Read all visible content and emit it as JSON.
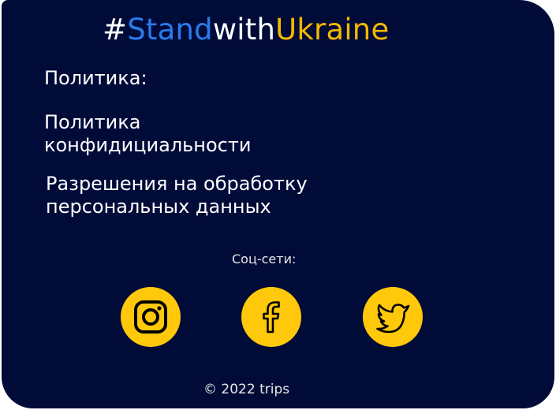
{
  "hashtag": {
    "prefix": "#",
    "part1": "Stand",
    "part2": "with",
    "part3": "Ukraine"
  },
  "policy": {
    "heading": "Политика:",
    "privacy_line1": "Политика",
    "privacy_line2": "конфидициальности",
    "consent_line1": "Разрешения на обработку",
    "consent_line2": "персональных данных"
  },
  "social": {
    "heading": "Соц-сети:",
    "links": [
      "instagram",
      "facebook",
      "twitter"
    ]
  },
  "copyright": "© 2022 trips",
  "colors": {
    "background": "#000b38",
    "accent_blue": "#2a7bec",
    "accent_yellow": "#f5b800",
    "icon_circle": "#ffc80a"
  }
}
